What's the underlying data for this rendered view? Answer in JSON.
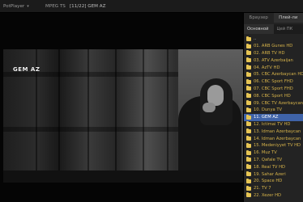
{
  "titlebar": {
    "app_name": "PotPlayer",
    "format": "MPEG TS",
    "title": "[11/22] GEM AZ"
  },
  "video": {
    "osd_logo": "GEM AZ"
  },
  "panel": {
    "tabs": [
      {
        "label": "Браузер",
        "active": false
      },
      {
        "label": "Плей-ли",
        "active": true
      }
    ],
    "subtabs": [
      {
        "label": "Основной",
        "active": true
      },
      {
        "label": "Цей ПК",
        "active": false
      }
    ],
    "items": [
      {
        "label": "..",
        "folder": true,
        "selected": false
      },
      {
        "label": "01. ARB Gunes HD",
        "folder": false,
        "selected": false
      },
      {
        "label": "02. ARB TV HD",
        "folder": false,
        "selected": false
      },
      {
        "label": "03. ATV Azerbaijan",
        "folder": false,
        "selected": false
      },
      {
        "label": "04. AzTV HD",
        "folder": false,
        "selected": false
      },
      {
        "label": "05. CBC Azerbaycan HD",
        "folder": false,
        "selected": false
      },
      {
        "label": "06. CBC Sport FHD",
        "folder": false,
        "selected": false
      },
      {
        "label": "07. CBC Sport FHD",
        "folder": false,
        "selected": false
      },
      {
        "label": "08. CBC Sport HD",
        "folder": false,
        "selected": false
      },
      {
        "label": "09. CBC TV Azerbaycan",
        "folder": false,
        "selected": false
      },
      {
        "label": "10. Dunya TV",
        "folder": false,
        "selected": false
      },
      {
        "label": "11. GEM AZ",
        "folder": false,
        "selected": true
      },
      {
        "label": "12. Ictimai TV HD",
        "folder": false,
        "selected": false
      },
      {
        "label": "13. Idman Azerbaycan",
        "folder": false,
        "selected": false
      },
      {
        "label": "14. Idman Azerbaycan",
        "folder": false,
        "selected": false
      },
      {
        "label": "15. Medeniyyet TV HD",
        "folder": false,
        "selected": false
      },
      {
        "label": "16. Muz TV",
        "folder": false,
        "selected": false
      },
      {
        "label": "17. Qafale TV",
        "folder": false,
        "selected": false
      },
      {
        "label": "18. Real TV HD",
        "folder": false,
        "selected": false
      },
      {
        "label": "19. Sahar Azeri",
        "folder": false,
        "selected": false
      },
      {
        "label": "20. Space HD",
        "folder": false,
        "selected": false
      },
      {
        "label": "21. TV 7",
        "folder": false,
        "selected": false
      },
      {
        "label": "22. Xezer HD",
        "folder": false,
        "selected": false
      }
    ]
  }
}
